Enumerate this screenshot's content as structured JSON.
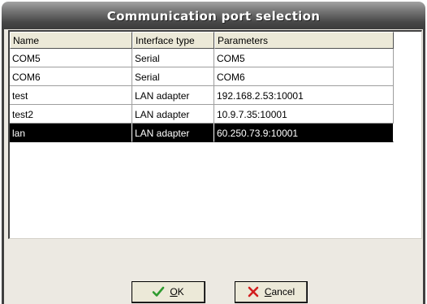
{
  "window": {
    "title": "Communication port selection"
  },
  "table": {
    "columns": [
      "Name",
      "Interface type",
      "Parameters"
    ],
    "rows": [
      {
        "name": "COM5",
        "type": "Serial",
        "params": "COM5",
        "selected": false
      },
      {
        "name": "COM6",
        "type": "Serial",
        "params": "COM6",
        "selected": false
      },
      {
        "name": "test",
        "type": "LAN adapter",
        "params": "192.168.2.53:10001",
        "selected": false
      },
      {
        "name": "test2",
        "type": "LAN adapter",
        "params": "10.9.7.35:10001",
        "selected": false
      },
      {
        "name": "lan",
        "type": "LAN adapter",
        "params": "60.250.73.9:10001",
        "selected": true
      }
    ]
  },
  "buttons": {
    "ok": {
      "accel": "O",
      "rest": "K",
      "icon": "checkmark-icon",
      "color": "#2e9a2e"
    },
    "cancel": {
      "accel": "C",
      "rest": "ancel",
      "icon": "red-x-icon",
      "color": "#d21e1e"
    }
  }
}
